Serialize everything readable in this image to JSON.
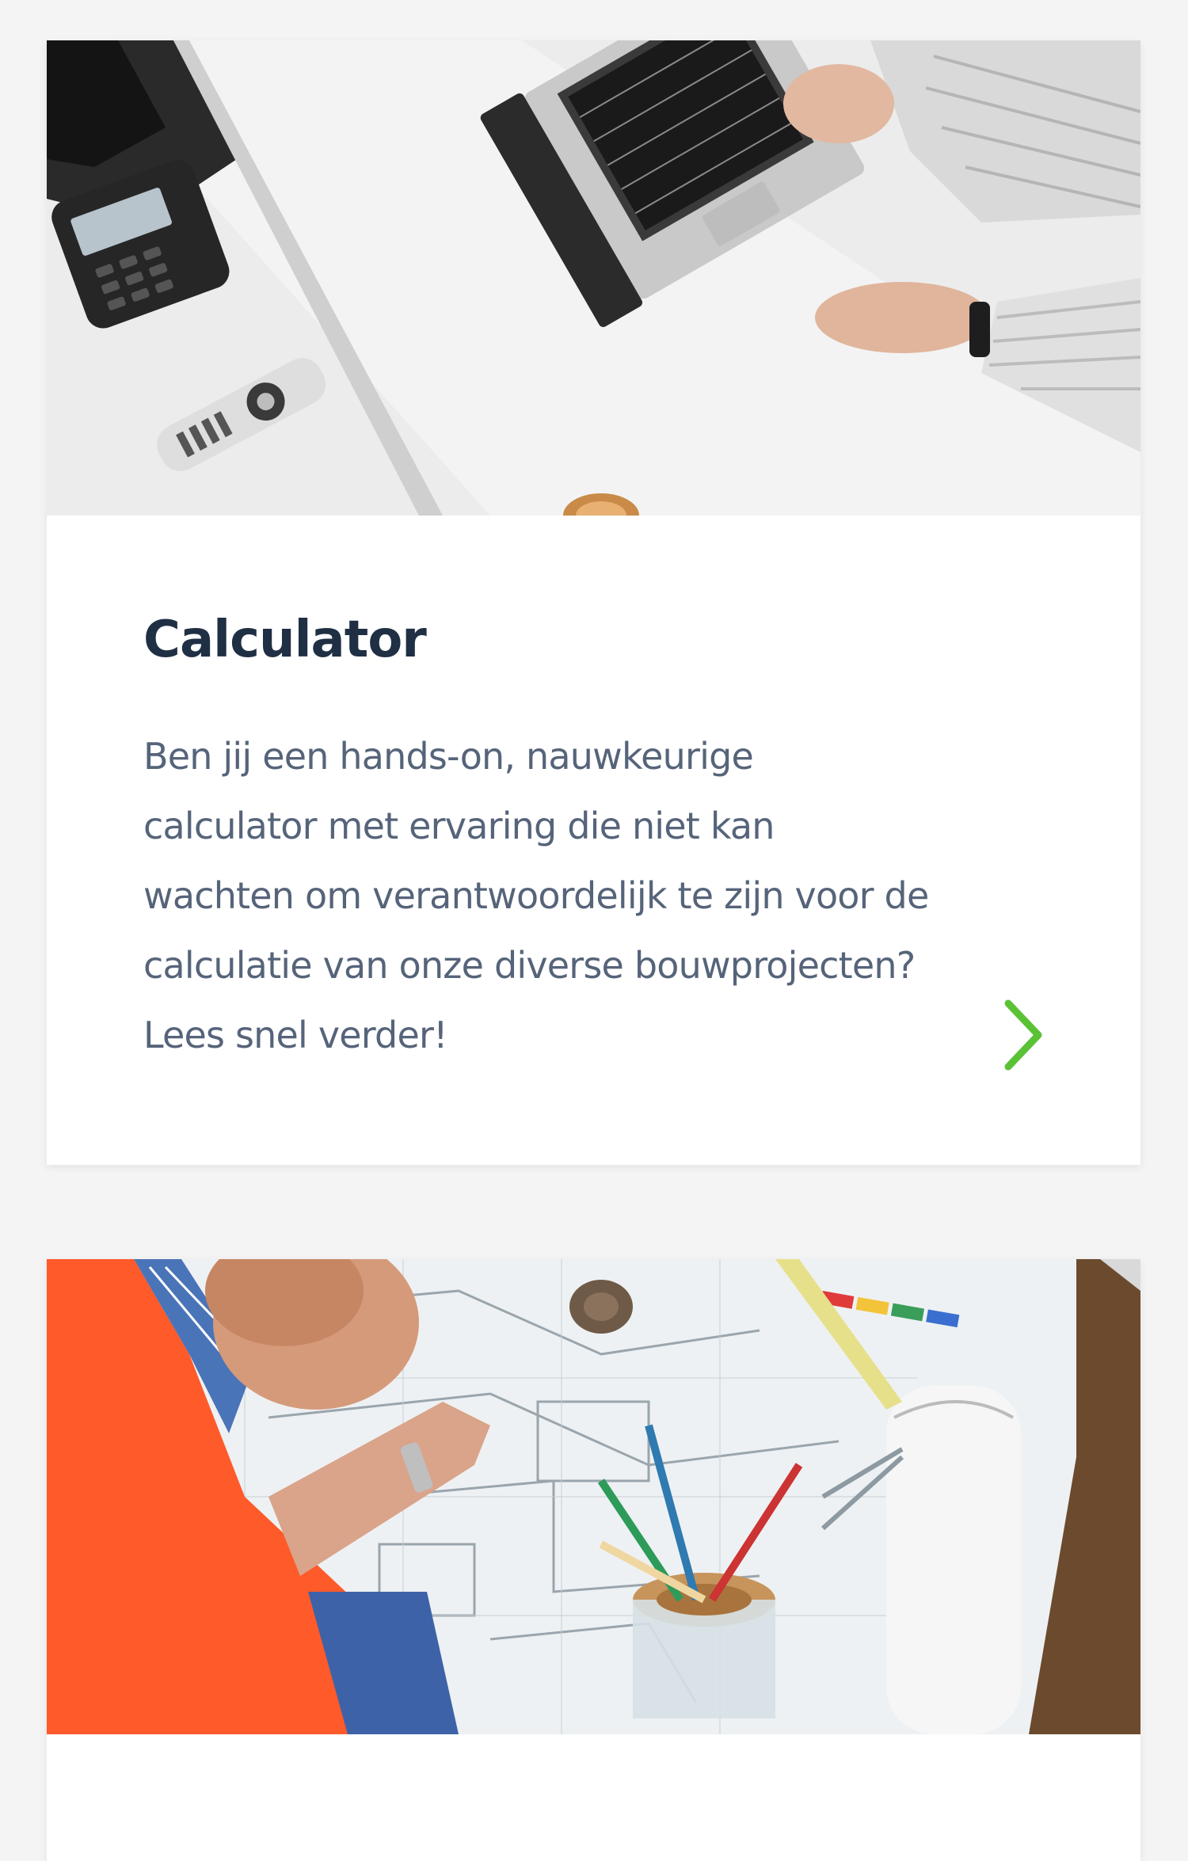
{
  "vacancies": [
    {
      "title": "Calculator",
      "description": "Ben jij een hands-on, nauwkeurige calculator met ervaring die niet kan wachten om verantwoordelijk te zijn voor de calculatie van onze diverse bouwprojecten? Lees snel verder!",
      "image_icon": "laptop-desk-photo",
      "link_icon": "chevron-right-icon"
    },
    {
      "image_icon": "blueprint-construction-photo"
    }
  ],
  "colors": {
    "page_background": "#f4f4f4",
    "card_background": "#ffffff",
    "title": "#1f2f44",
    "body_text": "#56647a",
    "accent_green": "#5bc236"
  }
}
